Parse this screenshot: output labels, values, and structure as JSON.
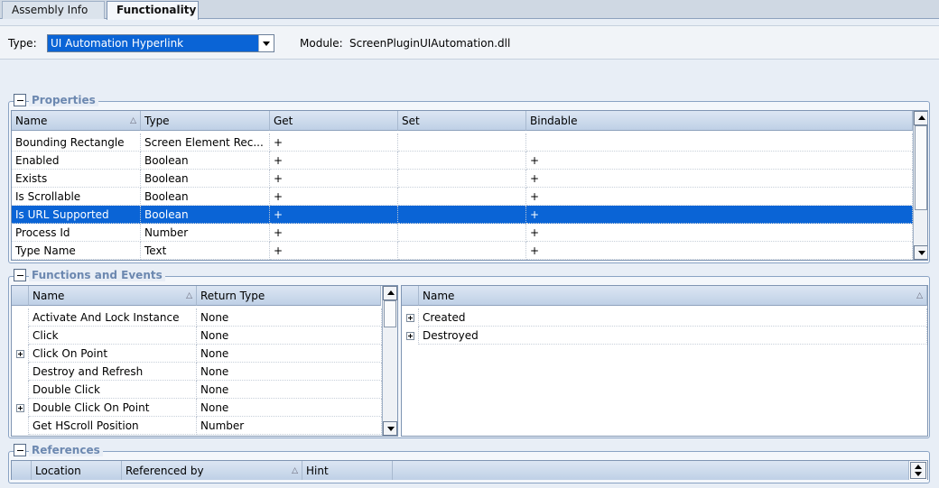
{
  "tabs": [
    {
      "label": "Assembly Info",
      "active": false
    },
    {
      "label": "Functionality",
      "active": true
    }
  ],
  "type_field": {
    "label": "Type:",
    "value": "UI Automation Hyperlink"
  },
  "module": {
    "label": "Module:",
    "value": "ScreenPluginUIAutomation.dll"
  },
  "properties": {
    "title": "Properties",
    "columns": [
      "Name",
      "Type",
      "Get",
      "Set",
      "Bindable"
    ],
    "rows": [
      [
        "Bounding Rectangle",
        "Screen Element Rec...",
        "+",
        "",
        ""
      ],
      [
        "Enabled",
        "Boolean",
        "+",
        "",
        "+"
      ],
      [
        "Exists",
        "Boolean",
        "+",
        "",
        "+"
      ],
      [
        "Is Scrollable",
        "Boolean",
        "+",
        "",
        "+"
      ],
      [
        "Is URL Supported",
        "Boolean",
        "+",
        "",
        "+"
      ],
      [
        "Process Id",
        "Number",
        "+",
        "",
        "+"
      ],
      [
        "Type Name",
        "Text",
        "+",
        "",
        "+"
      ]
    ],
    "selected_index": 4
  },
  "functions_events": {
    "title": "Functions and Events",
    "functions_columns": [
      "Name",
      "Return Type"
    ],
    "functions": [
      {
        "name": "Activate And Lock Instance",
        "return": "None",
        "expandable": false
      },
      {
        "name": "Click",
        "return": "None",
        "expandable": false
      },
      {
        "name": "Click On Point",
        "return": "None",
        "expandable": true
      },
      {
        "name": "Destroy and Refresh",
        "return": "None",
        "expandable": false
      },
      {
        "name": "Double Click",
        "return": "None",
        "expandable": false
      },
      {
        "name": "Double Click On Point",
        "return": "None",
        "expandable": true
      },
      {
        "name": "Get HScroll Position",
        "return": "Number",
        "expandable": false
      }
    ],
    "events_columns": [
      "Name"
    ],
    "events": [
      {
        "name": "Created",
        "expandable": true
      },
      {
        "name": "Destroyed",
        "expandable": true
      }
    ]
  },
  "references": {
    "title": "References",
    "columns": [
      "Location",
      "Referenced by",
      "Hint"
    ]
  }
}
